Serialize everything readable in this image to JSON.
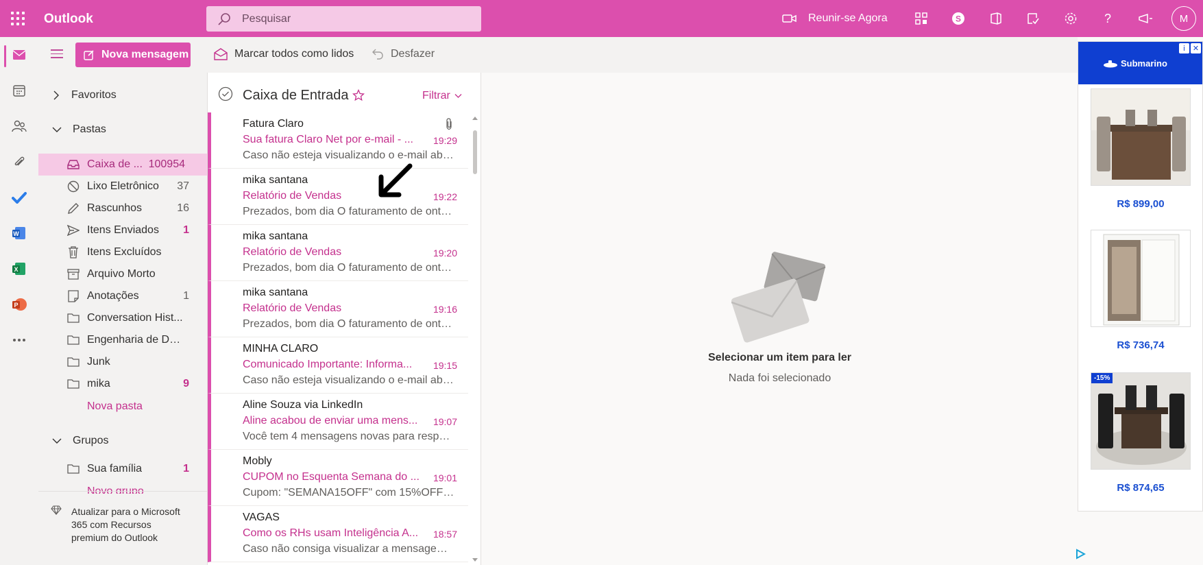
{
  "app": {
    "name": "Outlook"
  },
  "topbar": {
    "search_placeholder": "Pesquisar",
    "meet_now": "Reunir-se Agora",
    "avatar_initial": "M"
  },
  "commands": {
    "new_message": "Nova mensagem",
    "mark_all_read": "Marcar todos como lidos",
    "undo": "Desfazer"
  },
  "folders": {
    "favorites": "Favoritos",
    "folders_header": "Pastas",
    "items": [
      {
        "name": "Caixa de ...",
        "count": "100954",
        "icon": "inbox-icon"
      },
      {
        "name": "Lixo Eletrônico",
        "count": "37",
        "icon": "junk-icon"
      },
      {
        "name": "Rascunhos",
        "count": "16",
        "icon": "pencil-icon"
      },
      {
        "name": "Itens Enviados",
        "count": "1",
        "icon": "send-icon"
      },
      {
        "name": "Itens Excluídos",
        "count": "",
        "icon": "trash-icon"
      },
      {
        "name": "Arquivo Morto",
        "count": "",
        "icon": "archive-icon"
      },
      {
        "name": "Anotações",
        "count": "1",
        "icon": "note-icon"
      },
      {
        "name": "Conversation Hist...",
        "count": "",
        "icon": "folder-icon"
      },
      {
        "name": "Engenharia de Da...",
        "count": "",
        "icon": "folder-icon"
      },
      {
        "name": "Junk",
        "count": "",
        "icon": "folder-icon"
      },
      {
        "name": "mika",
        "count": "9",
        "icon": "folder-icon"
      }
    ],
    "new_folder": "Nova pasta",
    "groups_header": "Grupos",
    "groups": [
      {
        "name": "Sua família",
        "count": "1"
      }
    ],
    "new_group": "Novo grupo",
    "upgrade_text": "Atualizar para o Microsoft 365 com Recursos premium do Outlook"
  },
  "message_list": {
    "title": "Caixa de Entrada",
    "filter": "Filtrar",
    "messages": [
      {
        "sender": "Fatura Claro",
        "subject": "Sua fatura Claro Net por e-mail - ...",
        "time": "19:29",
        "preview": "Caso não esteja visualizando o e-mail abai...",
        "attachment": true
      },
      {
        "sender": "mika santana",
        "subject": "Relatório de Vendas",
        "time": "19:22",
        "preview": "Prezados, bom dia O faturamento de onte..."
      },
      {
        "sender": "mika santana",
        "subject": "Relatório de Vendas",
        "time": "19:20",
        "preview": "Prezados, bom dia O faturamento de onte..."
      },
      {
        "sender": "mika santana",
        "subject": "Relatório de Vendas",
        "time": "19:16",
        "preview": "Prezados, bom dia O faturamento de onte..."
      },
      {
        "sender": "MINHA CLARO",
        "subject": "Comunicado Importante: Informa...",
        "time": "19:15",
        "preview": "Caso não esteja visualizando o e-mail abai..."
      },
      {
        "sender": "Aline Souza via LinkedIn",
        "subject": "Aline acabou de enviar uma mens...",
        "time": "19:07",
        "preview": "Você tem 4 mensagens novas para respon..."
      },
      {
        "sender": "Mobly",
        "subject": "CUPOM no Esquenta Semana do ...",
        "time": "19:01",
        "preview": "Cupom: \"SEMANA15OFF\" com 15%OFF pr..."
      },
      {
        "sender": "VAGAS",
        "subject": "Como os RHs usam Inteligência A...",
        "time": "18:57",
        "preview": "Caso não consiga visualizar a mensagem, ..."
      }
    ]
  },
  "reading_pane": {
    "title": "Selecionar um item para ler",
    "subtitle": "Nada foi selecionado"
  },
  "ad": {
    "brand": "Submarino",
    "badge": "-15%",
    "products": [
      {
        "price": "R$ 899,00"
      },
      {
        "price": "R$ 736,74"
      },
      {
        "price": "R$ 874,65"
      }
    ]
  },
  "colors": {
    "accent": "#dc4fad",
    "accent_text": "#c4308d",
    "ad_blue": "#0f3fd1"
  }
}
